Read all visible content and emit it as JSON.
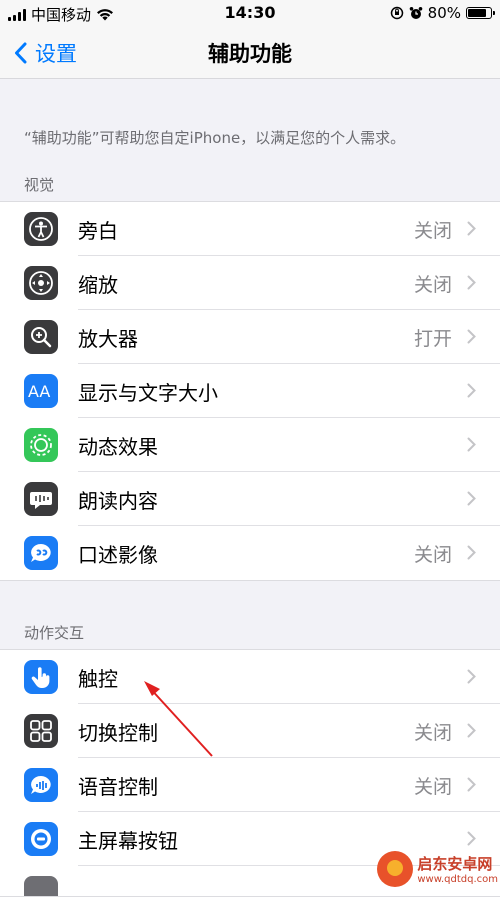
{
  "status_bar": {
    "carrier": "中国移动",
    "time": "14:30",
    "battery_percent": "80%",
    "battery_level": 0.8
  },
  "nav": {
    "back_label": "设置",
    "title": "辅助功能"
  },
  "description": "“辅助功能”可帮助您自定iPhone，以满足您的个人需求。",
  "sections": [
    {
      "header": "视觉",
      "items": [
        {
          "label": "旁白",
          "value": "关闭",
          "icon": "voiceover-icon",
          "color": "#3a3a3c"
        },
        {
          "label": "缩放",
          "value": "关闭",
          "icon": "zoom-icon",
          "color": "#3a3a3c"
        },
        {
          "label": "放大器",
          "value": "打开",
          "icon": "magnifier-icon",
          "color": "#3a3a3c"
        },
        {
          "label": "显示与文字大小",
          "value": "",
          "icon": "text-size-icon",
          "color": "#1a7cf5"
        },
        {
          "label": "动态效果",
          "value": "",
          "icon": "motion-icon",
          "color": "#34c759"
        },
        {
          "label": "朗读内容",
          "value": "",
          "icon": "spoken-content-icon",
          "color": "#3a3a3c"
        },
        {
          "label": "口述影像",
          "value": "关闭",
          "icon": "audio-description-icon",
          "color": "#1a7cf5"
        }
      ]
    },
    {
      "header": "动作交互",
      "items": [
        {
          "label": "触控",
          "value": "",
          "icon": "touch-icon",
          "color": "#1a7cf5"
        },
        {
          "label": "切换控制",
          "value": "关闭",
          "icon": "switch-control-icon",
          "color": "#3a3a3c"
        },
        {
          "label": "语音控制",
          "value": "关闭",
          "icon": "voice-control-icon",
          "color": "#1a7cf5"
        },
        {
          "label": "主屏幕按钮",
          "value": "",
          "icon": "home-button-icon",
          "color": "#1a7cf5"
        }
      ]
    }
  ],
  "watermark": {
    "name": "启东安卓网",
    "url": "www.qdtdq.com"
  }
}
